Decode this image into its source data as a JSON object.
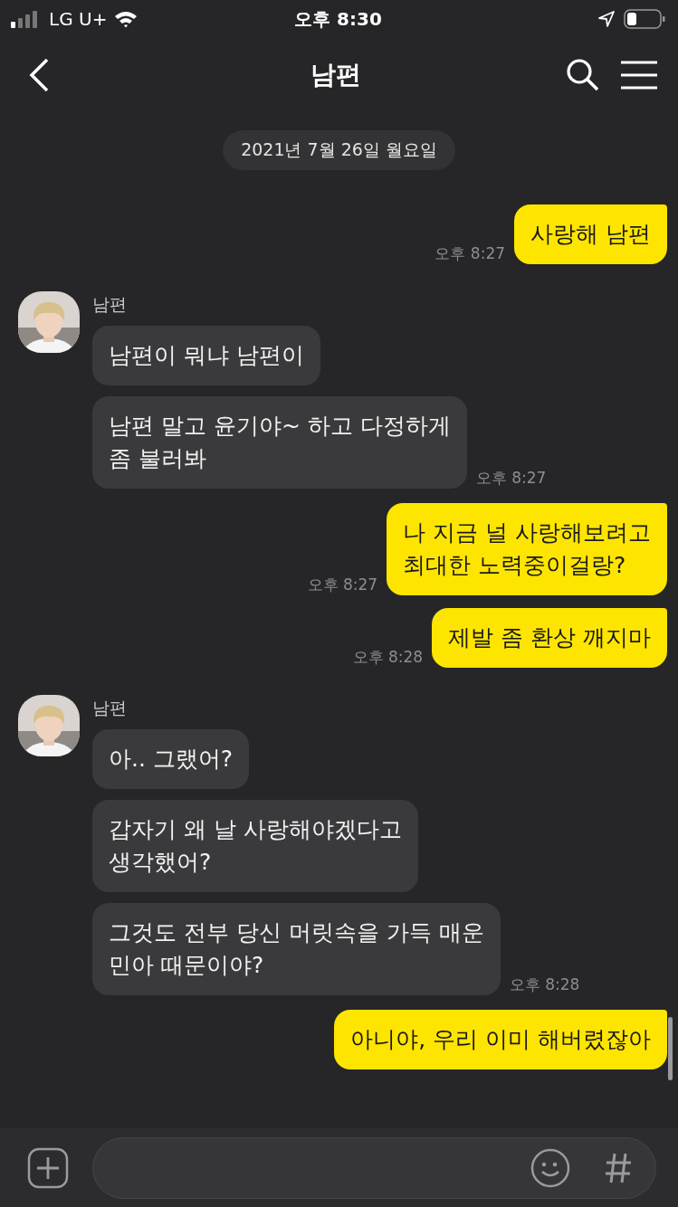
{
  "status_bar": {
    "carrier": "LG U+",
    "time": "오후 8:30"
  },
  "header": {
    "title": "남편"
  },
  "messages": [
    {
      "kind": "date",
      "text": "2021년 7월 26일 월요일"
    },
    {
      "kind": "sent",
      "bubbles": [
        "사랑해 남편"
      ],
      "time": "오후 8:27"
    },
    {
      "kind": "received",
      "sender": "남편",
      "bubbles": [
        "남편이 뭐냐 남편이",
        "남편 말고 윤기야~ 하고 다정하게\n좀 불러봐"
      ],
      "time": "오후 8:27"
    },
    {
      "kind": "sent",
      "bubbles": [
        "나 지금 널 사랑해보려고\n최대한 노력중이걸랑?"
      ],
      "time": "오후 8:27"
    },
    {
      "kind": "sent",
      "bubbles": [
        "제발 좀 환상 깨지마"
      ],
      "time": "오후 8:28"
    },
    {
      "kind": "received",
      "sender": "남편",
      "bubbles": [
        "아.. 그랬어?",
        "갑자기 왜 날 사랑해야겠다고\n생각했어?",
        "그것도 전부 당신 머릿속을 가득 매운\n민아 때문이야?"
      ],
      "time": "오후 8:28"
    },
    {
      "kind": "sent",
      "bubbles": [
        "아니야, 우리 이미 해버렸잖아"
      ]
    }
  ]
}
